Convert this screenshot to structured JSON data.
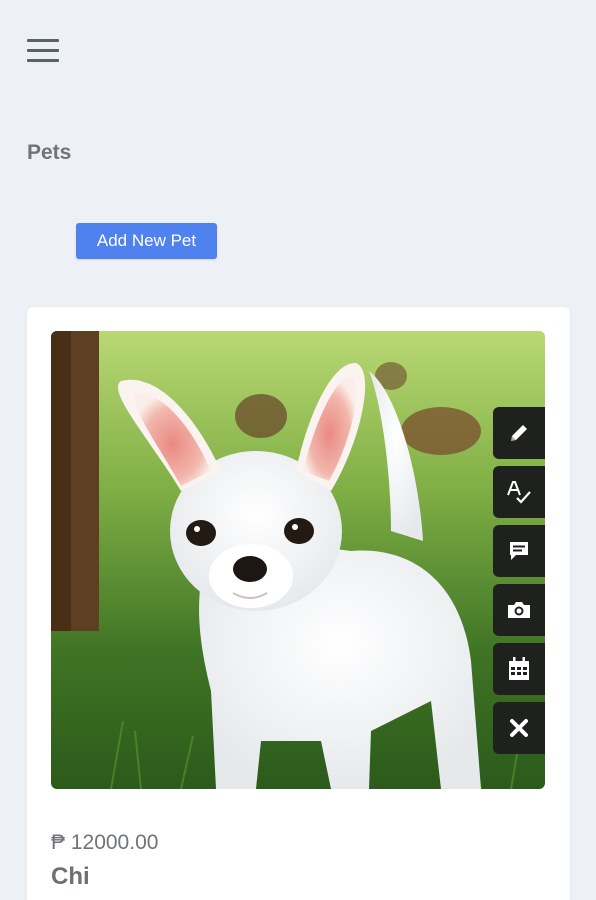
{
  "header": {
    "menu_icon": "hamburger-icon"
  },
  "page": {
    "title": "Pets"
  },
  "toolbar": {
    "add_label": "Add New Pet"
  },
  "pets": [
    {
      "price": "₱ 12000.00",
      "name": "Chi",
      "photo_subject": "white chihuahua puppy on grass",
      "actions": [
        {
          "icon": "pencil-icon",
          "action": "edit"
        },
        {
          "icon": "spellcheck-icon",
          "action": "rename"
        },
        {
          "icon": "comment-icon",
          "action": "comment"
        },
        {
          "icon": "camera-icon",
          "action": "photo"
        },
        {
          "icon": "calendar-icon",
          "action": "schedule"
        },
        {
          "icon": "close-icon",
          "action": "delete"
        }
      ]
    }
  ],
  "colors": {
    "background": "#edf0f4",
    "accent": "#4f82ee",
    "card": "#ffffff",
    "action_button": "#1f211e",
    "muted_text": "#6f757b"
  }
}
